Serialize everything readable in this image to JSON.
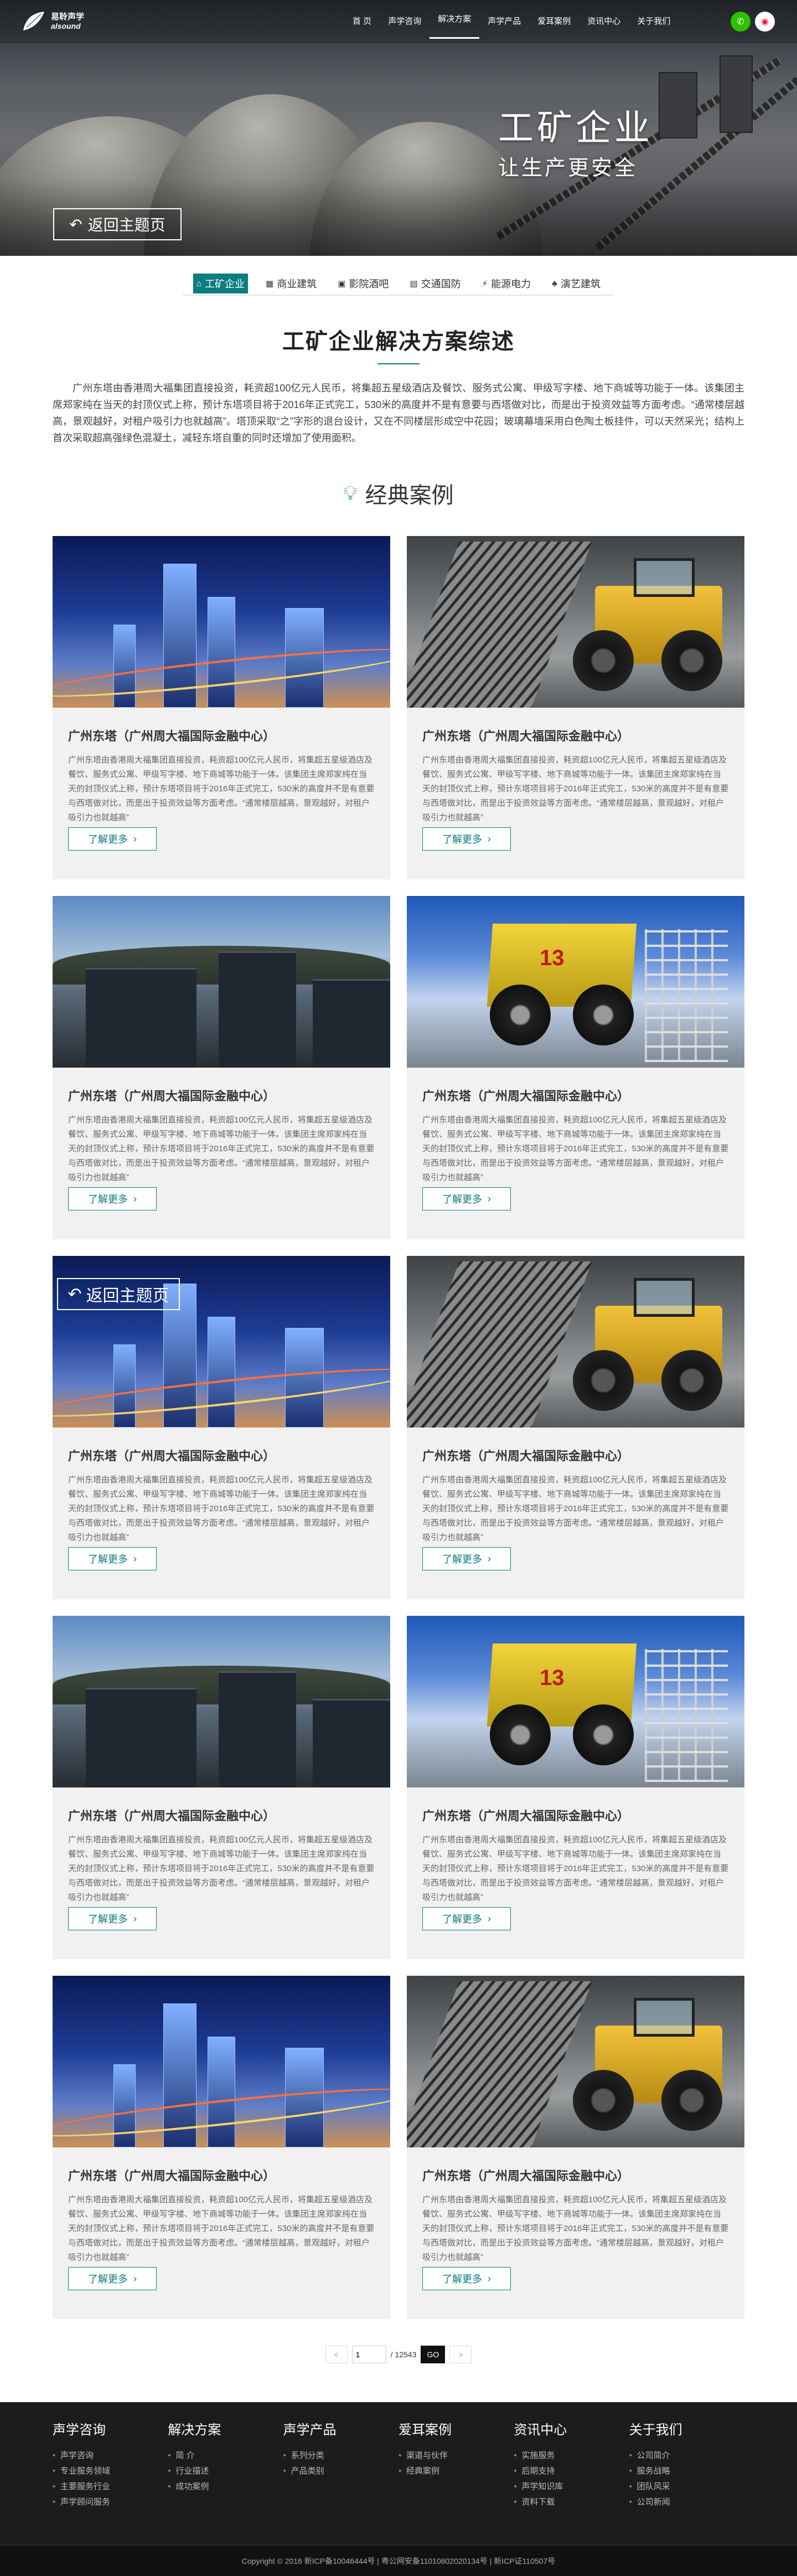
{
  "header": {
    "logo_cn": "易聆声学",
    "logo_en": "alsound",
    "menu": [
      "首 页",
      "声学咨询",
      "解决方案",
      "声学产品",
      "爱耳案例",
      "资讯中心",
      "关于我们"
    ],
    "social": [
      "wechat-icon",
      "weibo-icon"
    ]
  },
  "hero": {
    "title": "工矿企业",
    "subtitle": "让生产更安全",
    "back": "返回主题页"
  },
  "tabs": [
    {
      "label": "工矿企业",
      "icon": "factory-icon",
      "active": true
    },
    {
      "label": "商业建筑",
      "icon": "building-icon",
      "active": false
    },
    {
      "label": "影院酒吧",
      "icon": "cinema-icon",
      "active": false
    },
    {
      "label": "交通国防",
      "icon": "traffic-icon",
      "active": false
    },
    {
      "label": "能源电力",
      "icon": "power-icon",
      "active": false
    },
    {
      "label": "演艺建筑",
      "icon": "theater-icon",
      "active": false
    }
  ],
  "intro": {
    "title": "工矿企业解决方案综述",
    "text": "广州东塔由香港周大福集团直接投资，耗资超100亿元人民币，将集超五星级酒店及餐饮、服务式公寓、甲级写字楼、地下商城等功能于一体。该集团主席郑家纯在当天的封顶仪式上称，预计东塔项目将于2016年正式完工，530米的高度并不是有意要与西塔做对比，而是出于投资效益等方面考虑。“通常楼层越高，景观越好，对租户吸引力也就越高”。塔顶采取“之”字形的退台设计，又在不同楼层形成空中花园；玻璃幕墙采用白色陶土板挂件，可以天然采光；结构上首次采取超高强绿色混凝土，减轻东塔自重的同时还增加了使用面积。"
  },
  "cases": {
    "title": "经典案例",
    "card_title": "广州东塔（广州周大福国际金融中心）",
    "card_text": "广州东塔由香港周大福集团直接投资，耗资超100亿元人民币，将集超五星级酒店及餐饮、服务式公寓、甲级写字楼、地下商城等功能于一体。该集团主席郑家纯在当天的封顶仪式上称，预计东塔项目将于2016年正式完工，530米的高度并不是有意要与西塔做对比，而是出于投资效益等方面考虑。“通常楼层越高，景观越好，对租户吸引力也就越高”",
    "more": "了解更多",
    "overlay_back": "返回主题页"
  },
  "pager": {
    "prev": "<",
    "next": ">",
    "current": "1",
    "total": "/ 12543",
    "go": "GO"
  },
  "footer": {
    "cols": [
      {
        "title": "声学咨询",
        "items": [
          "声学咨询",
          "专业服务领域",
          "主要服务行业",
          "声学顾问服务"
        ]
      },
      {
        "title": "解决方案",
        "items": [
          "简 介",
          "行业描述",
          "成功案例"
        ]
      },
      {
        "title": "声学产品",
        "items": [
          "系列分类",
          "产品类别"
        ]
      },
      {
        "title": "爱耳案例",
        "items": [
          "渠道与伙伴",
          "经典案例"
        ]
      },
      {
        "title": "资讯中心",
        "items": [
          "实施服务",
          "后期支持",
          "声学知识库",
          "资料下载"
        ]
      },
      {
        "title": "关于我们",
        "items": [
          "公司简介",
          "服务战略",
          "团队风采",
          "公司新闻"
        ]
      }
    ],
    "copyright": "Copyright © 2016  新ICP备10046444号 | 粤公网安备11010802020134号 | 新ICP证110507号"
  }
}
